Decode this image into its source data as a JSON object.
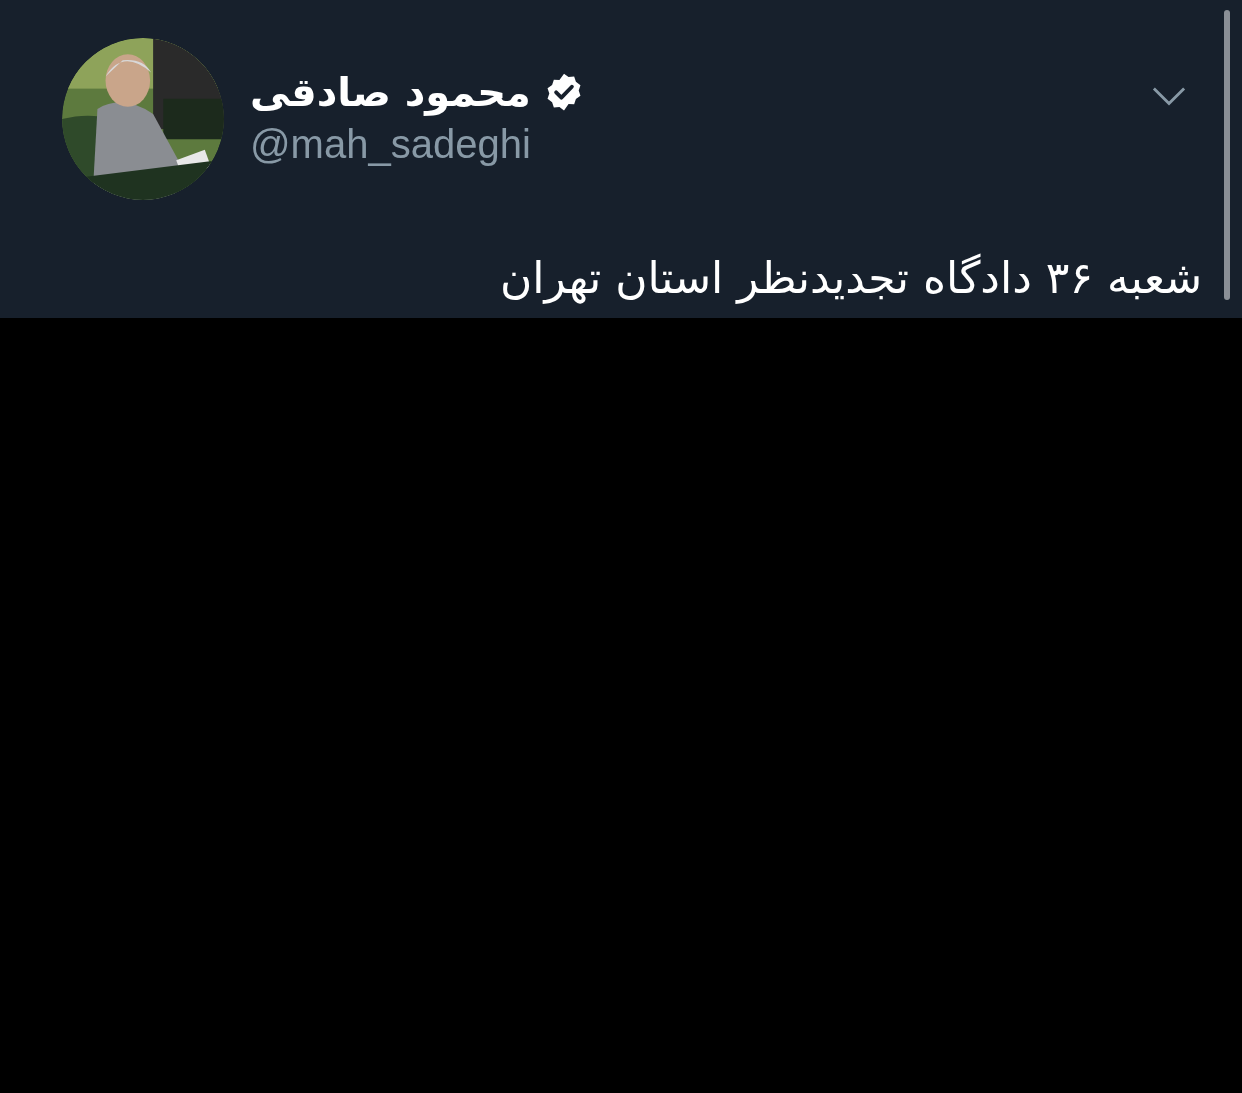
{
  "tweet": {
    "author": {
      "name": "محمود صادقی",
      "verified": true,
      "handle": "@mah_sadeghi"
    },
    "text": "شعبه ۳۶ دادگاه تجدیدنظر استان تهران"
  }
}
